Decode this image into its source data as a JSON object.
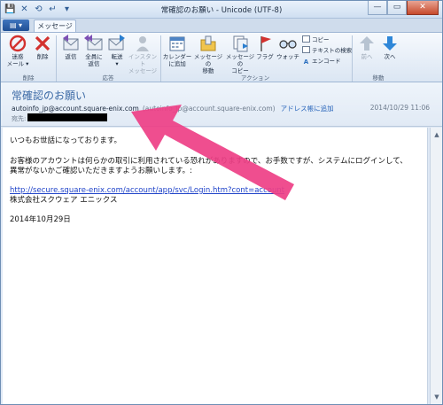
{
  "window": {
    "title": "常確認のお願い - Unicode (UTF-8)",
    "controls": {
      "minimize": "—",
      "maximize": "▭",
      "close": "✕"
    }
  },
  "quick_access": [
    "💾",
    "✕",
    "⟲",
    "↵",
    "▾"
  ],
  "tabs": {
    "file_label": "▤ ▾",
    "message_label": "メッセージ"
  },
  "ribbon": {
    "groups": [
      {
        "name": "削除",
        "buttons": [
          {
            "label": "迷惑\nメール ▾",
            "icon": "junk-mail-icon"
          },
          {
            "label": "削除",
            "icon": "delete-icon"
          }
        ]
      },
      {
        "name": "応答",
        "buttons": [
          {
            "label": "返信",
            "icon": "reply-icon"
          },
          {
            "label": "全員に\n返信",
            "icon": "reply-all-icon"
          },
          {
            "label": "転送\n▾",
            "icon": "forward-icon"
          },
          {
            "label": "インスタント\nメッセージ",
            "icon": "instant-message-icon",
            "disabled": true
          }
        ]
      },
      {
        "name": "アクション",
        "buttons": [
          {
            "label": "カレンダー\nに追加",
            "icon": "calendar-icon"
          },
          {
            "label": "メッセージの\n移動",
            "icon": "move-message-icon"
          },
          {
            "label": "メッセージの\nコピー",
            "icon": "copy-message-icon"
          },
          {
            "label": "フラグ",
            "icon": "flag-icon"
          },
          {
            "label": "ウォッチ",
            "icon": "watch-glasses-icon"
          }
        ]
      },
      {
        "name": "移動",
        "buttons": [
          {
            "label": "前へ",
            "icon": "previous-arrow-icon",
            "disabled": true
          },
          {
            "label": "次へ",
            "icon": "next-arrow-icon"
          }
        ]
      }
    ],
    "small_actions": [
      {
        "label": "コピー",
        "icon": "copy-icon"
      },
      {
        "label": "テキストの検索",
        "icon": "find-text-icon"
      },
      {
        "label": "エンコード",
        "icon": "encoding-icon"
      }
    ]
  },
  "message": {
    "subject": "常確認のお願い",
    "from_display": "autoinfo_jp@account.square-enix.com",
    "from_address": "(autoinfo_jp@account.square-enix.com)",
    "add_contact": "アドレス帳に追加",
    "date": "2014/10/29 11:06",
    "to_label": "宛先:",
    "body_lines": [
      "いつもお世話になっております。",
      "お客様のアカウントは何らかの取引に利用されている恐れがありますので、お手数ですが、システムにログインして、",
      "異常がないかご確認いただきますようお願いします。:",
      "http://secure.square-enix.com/account/app/svc/Login.htm?cont=account",
      "株式会社スクウェア エニックス",
      "2014年10月29日"
    ]
  },
  "colors": {
    "annotation_arrow": "#ee3f86",
    "link": "#1f43c9",
    "subject": "#3c6aa6"
  }
}
